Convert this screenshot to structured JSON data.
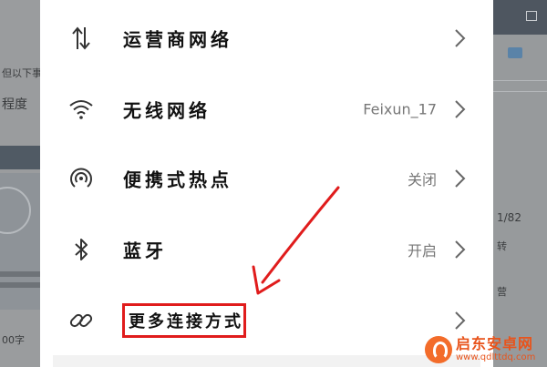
{
  "settings": {
    "items": [
      {
        "label": "运营商网络",
        "value": "",
        "icon": "mobile-data-arrows-icon"
      },
      {
        "label": "无线网络",
        "value": "Feixun_17",
        "icon": "wifi-icon"
      },
      {
        "label": "便携式热点",
        "value": "关闭",
        "icon": "hotspot-icon"
      },
      {
        "label": "蓝牙",
        "value": "开启",
        "icon": "bluetooth-icon"
      },
      {
        "label": "更多连接方式",
        "value": "",
        "icon": "link-icon"
      }
    ]
  },
  "annotation": {
    "highlight_color": "#e01c1c"
  },
  "background": {
    "left_fragments": [
      "但以下事",
      "程度",
      "00字"
    ],
    "right_fragments": [
      "1/82",
      "转",
      "营"
    ]
  },
  "watermark": {
    "title": "启东安卓网",
    "url": "www.qdlttdq.com",
    "color": "#e8541c"
  }
}
